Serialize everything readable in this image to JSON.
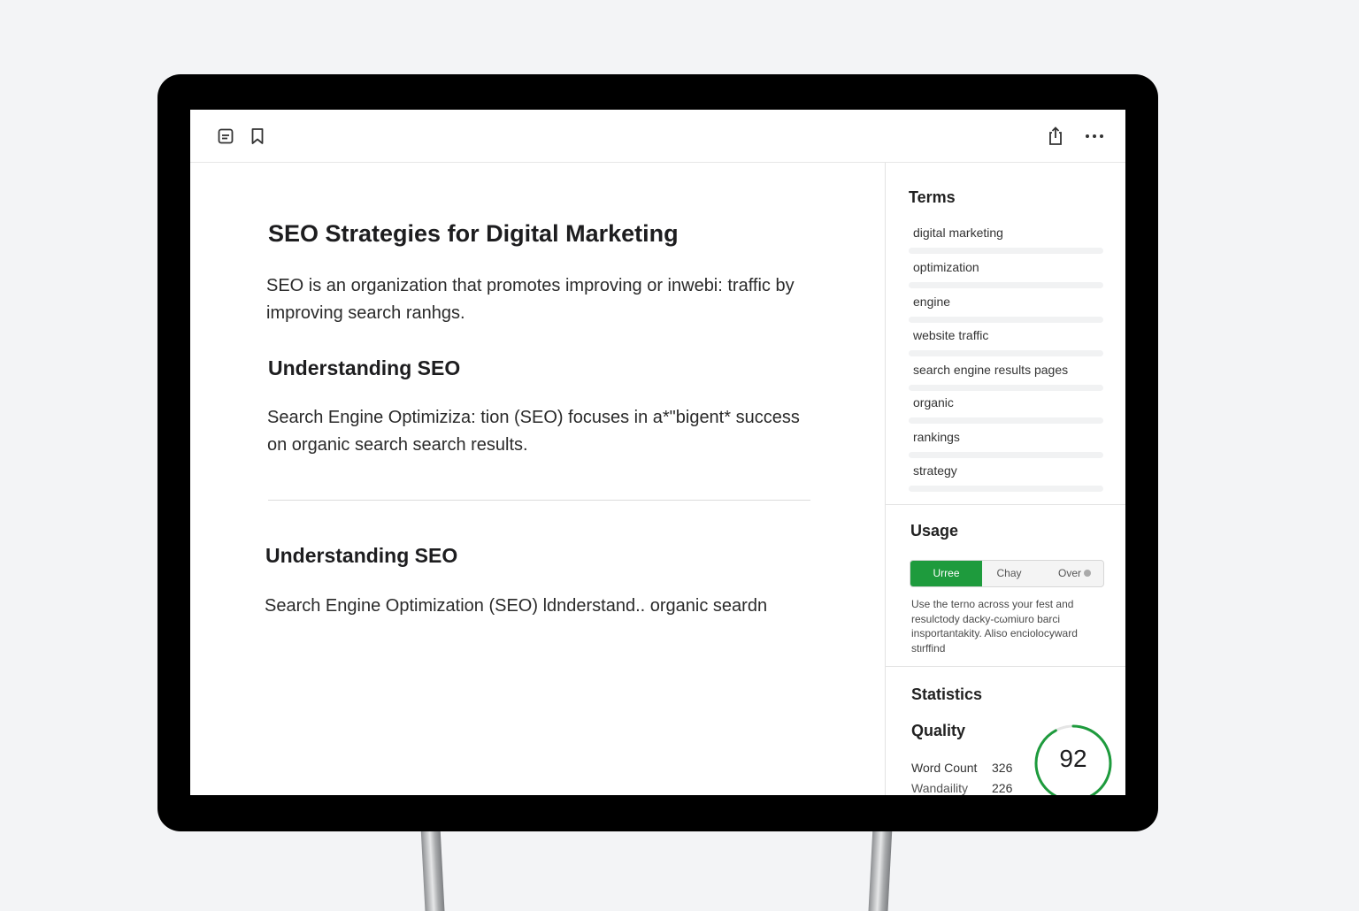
{
  "toolbar": {
    "left_icons": [
      "document-icon",
      "bookmark-icon"
    ],
    "right_icons": [
      "share-icon",
      "more-icon"
    ]
  },
  "document": {
    "title": "SEO Strategies for Digital Marketing",
    "intro_line1": "SEO is an organization that promotes improving or inwebi: traffic by",
    "intro_line2": "improving search ranhgs.",
    "section1_heading": "Understanding SEO",
    "section1_line1": "Search Engine Optimiziza: tion (SEO) focuses in a*\"bigent* success",
    "section1_line2": "on organic search search results.",
    "section2_heading": "Understanding SEO",
    "section2_line1": "Search Engine Optimization (SEO) ldnderstand.. organic seardn"
  },
  "sidebar": {
    "terms_title": "Terms",
    "terms": [
      {
        "label": "digital marketing"
      },
      {
        "label": "optimization"
      },
      {
        "label": "engine"
      },
      {
        "label": "website traffic"
      },
      {
        "label": "search engine results pages"
      },
      {
        "label": "organic"
      },
      {
        "label": "rankings"
      },
      {
        "label": "strategy"
      }
    ],
    "usage_title": "Usage",
    "usage_tabs": [
      {
        "label": "Urree",
        "active": true
      },
      {
        "label": "Chay",
        "active": false
      },
      {
        "label": "Over",
        "active": false
      }
    ],
    "usage_note": "Use the terno across your fest and resulctody dacky-cωmiuro barci insportantakity. Aliso enciolocyward stιrffind",
    "statistics_title": "Statistics",
    "quality_title": "Quality",
    "stats": [
      {
        "label": "Word Count",
        "value": "326"
      },
      {
        "label": "Wandaility",
        "value": "226"
      }
    ],
    "quality_score": "92",
    "accent_color": "#1e9b3d"
  }
}
